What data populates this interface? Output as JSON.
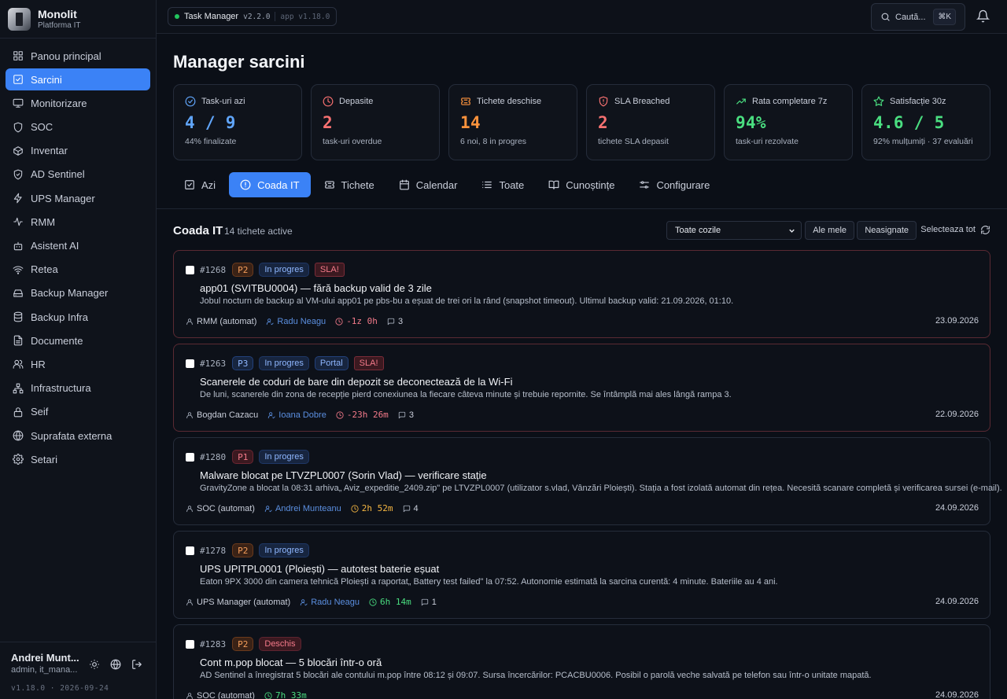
{
  "brand": {
    "name": "Monolit",
    "subtitle": "Platforma IT"
  },
  "sidebar": {
    "items": [
      {
        "label": "Panou principal",
        "icon": "grid-icon"
      },
      {
        "label": "Sarcini",
        "icon": "checkbox-icon",
        "active": true
      },
      {
        "label": "Monitorizare",
        "icon": "monitor-icon"
      },
      {
        "label": "SOC",
        "icon": "shield-icon"
      },
      {
        "label": "Inventar",
        "icon": "box-icon"
      },
      {
        "label": "AD Sentinel",
        "icon": "shield-check-icon"
      },
      {
        "label": "UPS Manager",
        "icon": "bolt-icon"
      },
      {
        "label": "RMM",
        "icon": "activity-icon"
      },
      {
        "label": "Asistent AI",
        "icon": "bot-icon"
      },
      {
        "label": "Retea",
        "icon": "wifi-icon"
      },
      {
        "label": "Backup Manager",
        "icon": "hard-drive-icon"
      },
      {
        "label": "Backup Infra",
        "icon": "database-icon"
      },
      {
        "label": "Documente",
        "icon": "file-icon"
      },
      {
        "label": "HR",
        "icon": "users-icon"
      },
      {
        "label": "Infrastructura",
        "icon": "network-icon"
      },
      {
        "label": "Seif",
        "icon": "lock-icon"
      },
      {
        "label": "Suprafata externa",
        "icon": "globe-icon"
      },
      {
        "label": "Setari",
        "icon": "gear-icon"
      }
    ],
    "user": {
      "name": "Andrei Munt...",
      "role": "admin, it_mana..."
    },
    "version": "v1.18.0 · 2026-09-24"
  },
  "topbar": {
    "app_name": "Task Manager",
    "app_version": "v2.2.0",
    "platform_version": "app v1.18.0",
    "search_label": "Caută...",
    "search_shortcut": "⌘K"
  },
  "page": {
    "title": "Manager sarcini"
  },
  "kpis": [
    {
      "label": "Task-uri azi",
      "value": "4 / 9",
      "sub": "44% finalizate",
      "color": "#60a5fa",
      "icon": "check-circle-icon"
    },
    {
      "label": "Depasite",
      "value": "2",
      "sub": "task-uri overdue",
      "color": "#f87171",
      "icon": "clock-icon"
    },
    {
      "label": "Tichete deschise",
      "value": "14",
      "sub": "6 noi, 8 in progres",
      "color": "#fb923c",
      "icon": "ticket-icon"
    },
    {
      "label": "SLA Breached",
      "value": "2",
      "sub": "tichete SLA depasit",
      "color": "#f87171",
      "icon": "shield-alert-icon"
    },
    {
      "label": "Rata completare 7z",
      "value": "94%",
      "sub": "task-uri rezolvate",
      "color": "#4ade80",
      "icon": "trend-up-icon"
    },
    {
      "label": "Satisfacție 30z",
      "value": "4.6 / 5",
      "sub": "92% mulțumiți · 37 evaluări",
      "color": "#4ade80",
      "icon": "star-icon"
    }
  ],
  "tabs": [
    {
      "label": "Azi",
      "icon": "checkbox-icon"
    },
    {
      "label": "Coada IT",
      "icon": "alert-circle-icon",
      "active": true
    },
    {
      "label": "Tichete",
      "icon": "ticket-icon"
    },
    {
      "label": "Calendar",
      "icon": "calendar-icon"
    },
    {
      "label": "Toate",
      "icon": "list-icon"
    },
    {
      "label": "Cunoștințe",
      "icon": "book-icon"
    },
    {
      "label": "Configurare",
      "icon": "sliders-icon"
    }
  ],
  "queue": {
    "title": "Coada IT",
    "count": "14 tichete active",
    "filter_value": "Toate cozile",
    "mine_label": "Ale mele",
    "unassigned_label": "Neasignate",
    "select_all_label": "Selecteaza tot"
  },
  "tickets": [
    {
      "id": "#1268",
      "priority": "P2",
      "status": "In progres",
      "tags": [
        "SLA!"
      ],
      "sla": true,
      "title": "app01 (SVITBU0004) — fără backup valid de 3 zile",
      "desc": "Jobul nocturn de backup al VM-ului app01 pe pbs-bu a eșuat de trei ori la rând (snapshot timeout). Ultimul backup valid: 21.09.2026, 01:10.",
      "requester": "RMM (automat)",
      "assignee": "Radu Neagu",
      "timer": "-1z 0h",
      "timer_tone": "red",
      "comments": "3",
      "date": "23.09.2026"
    },
    {
      "id": "#1263",
      "priority": "P3",
      "status": "In progres",
      "tags": [
        "Portal",
        "SLA!"
      ],
      "sla": true,
      "title": "Scanerele de coduri de bare din depozit se deconectează de la Wi-Fi",
      "desc": "De luni, scanerele din zona de recepție pierd conexiunea la fiecare câteva minute și trebuie repornite. Se întâmplă mai ales lângă rampa 3.",
      "requester": "Bogdan Cazacu",
      "assignee": "Ioana Dobre",
      "timer": "-23h 26m",
      "timer_tone": "red",
      "comments": "3",
      "date": "22.09.2026"
    },
    {
      "id": "#1280",
      "priority": "P1",
      "status": "In progres",
      "tags": [],
      "sla": false,
      "title": "Malware blocat pe LTVZPL0007 (Sorin Vlad) — verificare stație",
      "desc": "GravityZone a blocat la 08:31 arhiva„ Aviz_expeditie_2409.zip\" pe LTVZPL0007 (utilizator s.vlad, Vânzări Ploiești). Stația a fost izolată automat din rețea. Necesită scanare completă și verificarea sursei (e-mail).",
      "requester": "SOC (automat)",
      "assignee": "Andrei Munteanu",
      "timer": "2h 52m",
      "timer_tone": "amber",
      "comments": "4",
      "date": "24.09.2026"
    },
    {
      "id": "#1278",
      "priority": "P2",
      "status": "In progres",
      "tags": [],
      "sla": false,
      "title": "UPS UPITPL0001 (Ploiești) — autotest baterie eșuat",
      "desc": "Eaton 9PX 3000 din camera tehnică Ploiești a raportat„ Battery test failed\" la 07:52. Autonomie estimată la sarcina curentă: 4 minute. Bateriile au 4 ani.",
      "requester": "UPS Manager (automat)",
      "assignee": "Radu Neagu",
      "timer": "6h 14m",
      "timer_tone": "green",
      "comments": "1",
      "date": "24.09.2026"
    },
    {
      "id": "#1283",
      "priority": "P2",
      "status": "Deschis",
      "tags": [],
      "sla": false,
      "title": "Cont m.pop blocat — 5 blocări într-o oră",
      "desc": "AD Sentinel a înregistrat 5 blocări ale contului m.pop între 08:12 și 09:07. Sursa încercărilor: PCACBU0006. Posibil o parolă veche salvată pe telefon sau într-o unitate mapată.",
      "requester": "SOC (automat)",
      "assignee": "",
      "timer": "7h 33m",
      "timer_tone": "green",
      "comments": "",
      "date": "24.09.2026"
    }
  ]
}
